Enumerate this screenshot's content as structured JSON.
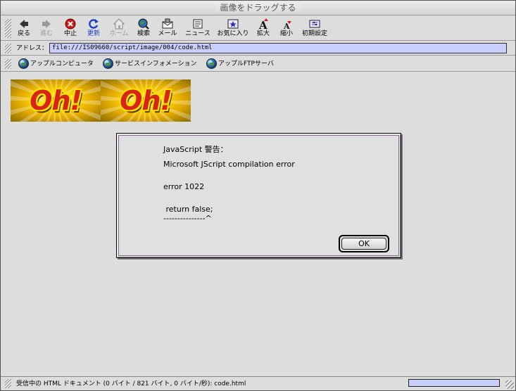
{
  "window": {
    "title": "画像をドラッグする"
  },
  "toolbar": {
    "buttons": [
      {
        "label": "戻る",
        "icon": "back-arrow-icon"
      },
      {
        "label": "進む",
        "icon": "forward-arrow-icon"
      },
      {
        "label": "中止",
        "icon": "stop-icon"
      },
      {
        "label": "更新",
        "icon": "refresh-icon"
      },
      {
        "label": "ホーム",
        "icon": "home-icon"
      },
      {
        "label": "検索",
        "icon": "search-globe-icon"
      },
      {
        "label": "メール",
        "icon": "mail-icon"
      },
      {
        "label": "ニュース",
        "icon": "news-icon"
      },
      {
        "label": "お気に入り",
        "icon": "favorites-icon"
      },
      {
        "label": "拡大",
        "icon": "text-larger-icon"
      },
      {
        "label": "縮小",
        "icon": "text-smaller-icon"
      },
      {
        "label": "初期設定",
        "icon": "preferences-icon"
      }
    ]
  },
  "address": {
    "label": "アドレス：",
    "value": "file:///IS09660/script/image/004/code.html"
  },
  "favorites": {
    "items": [
      {
        "label": "アップルコンピュータ"
      },
      {
        "label": "サービスインフォメーション"
      },
      {
        "label": "アップルFTPサーバ"
      }
    ]
  },
  "content": {
    "banner_text": "Oh!"
  },
  "dialog": {
    "title": "JavaScript 警告：",
    "line1": "Microsoft JScript compilation error",
    "line2": "error 1022",
    "line3": " return false;",
    "line4": "---------------^",
    "ok_label": "OK"
  },
  "status": {
    "text": "受信中の HTML ドキュメント (0 バイト / 821 バイト, 0 バイト/秒): code.html",
    "progress": 0
  },
  "colors": {
    "address_bg": "#c9d0ff",
    "active_label": "#1a3ccc",
    "stop_red": "#d01818"
  }
}
